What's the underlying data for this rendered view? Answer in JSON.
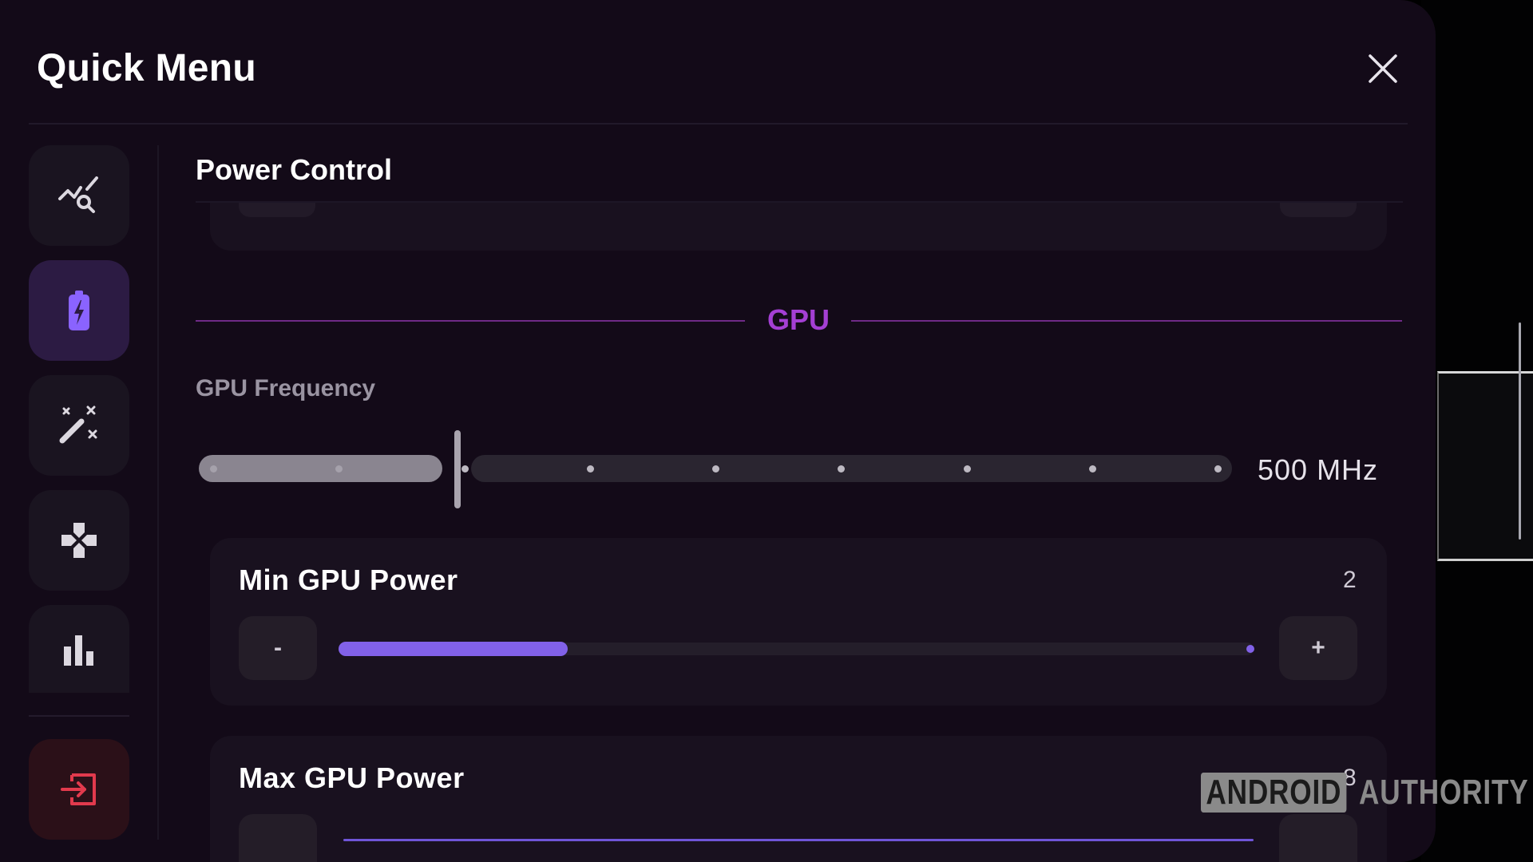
{
  "header": {
    "title": "Quick Menu"
  },
  "rail": {
    "items": [
      {
        "icon": "performance-monitor-icon"
      },
      {
        "icon": "battery-charging-icon",
        "active": true
      },
      {
        "icon": "magic-wand-icon"
      },
      {
        "icon": "gamepad-icon"
      },
      {
        "icon": "bar-chart-icon"
      }
    ],
    "exit_icon": "exit-icon"
  },
  "section": {
    "title": "Power Control"
  },
  "gpu": {
    "heading": "GPU",
    "frequency": {
      "label": "GPU Frequency",
      "value_text": "500 MHz",
      "steps": 9,
      "selected_step": 2
    },
    "min_power": {
      "label": "Min GPU Power",
      "value": "2",
      "minus": "-",
      "plus": "+",
      "fraction": 0.25
    },
    "max_power": {
      "label": "Max GPU Power",
      "value": "8"
    }
  },
  "watermark": {
    "box": "ANDROID",
    "text": "AUTHORITY"
  },
  "colors": {
    "accent": "#8161e8",
    "gpu_heading": "#a43fd4",
    "panel": "#130a18"
  }
}
